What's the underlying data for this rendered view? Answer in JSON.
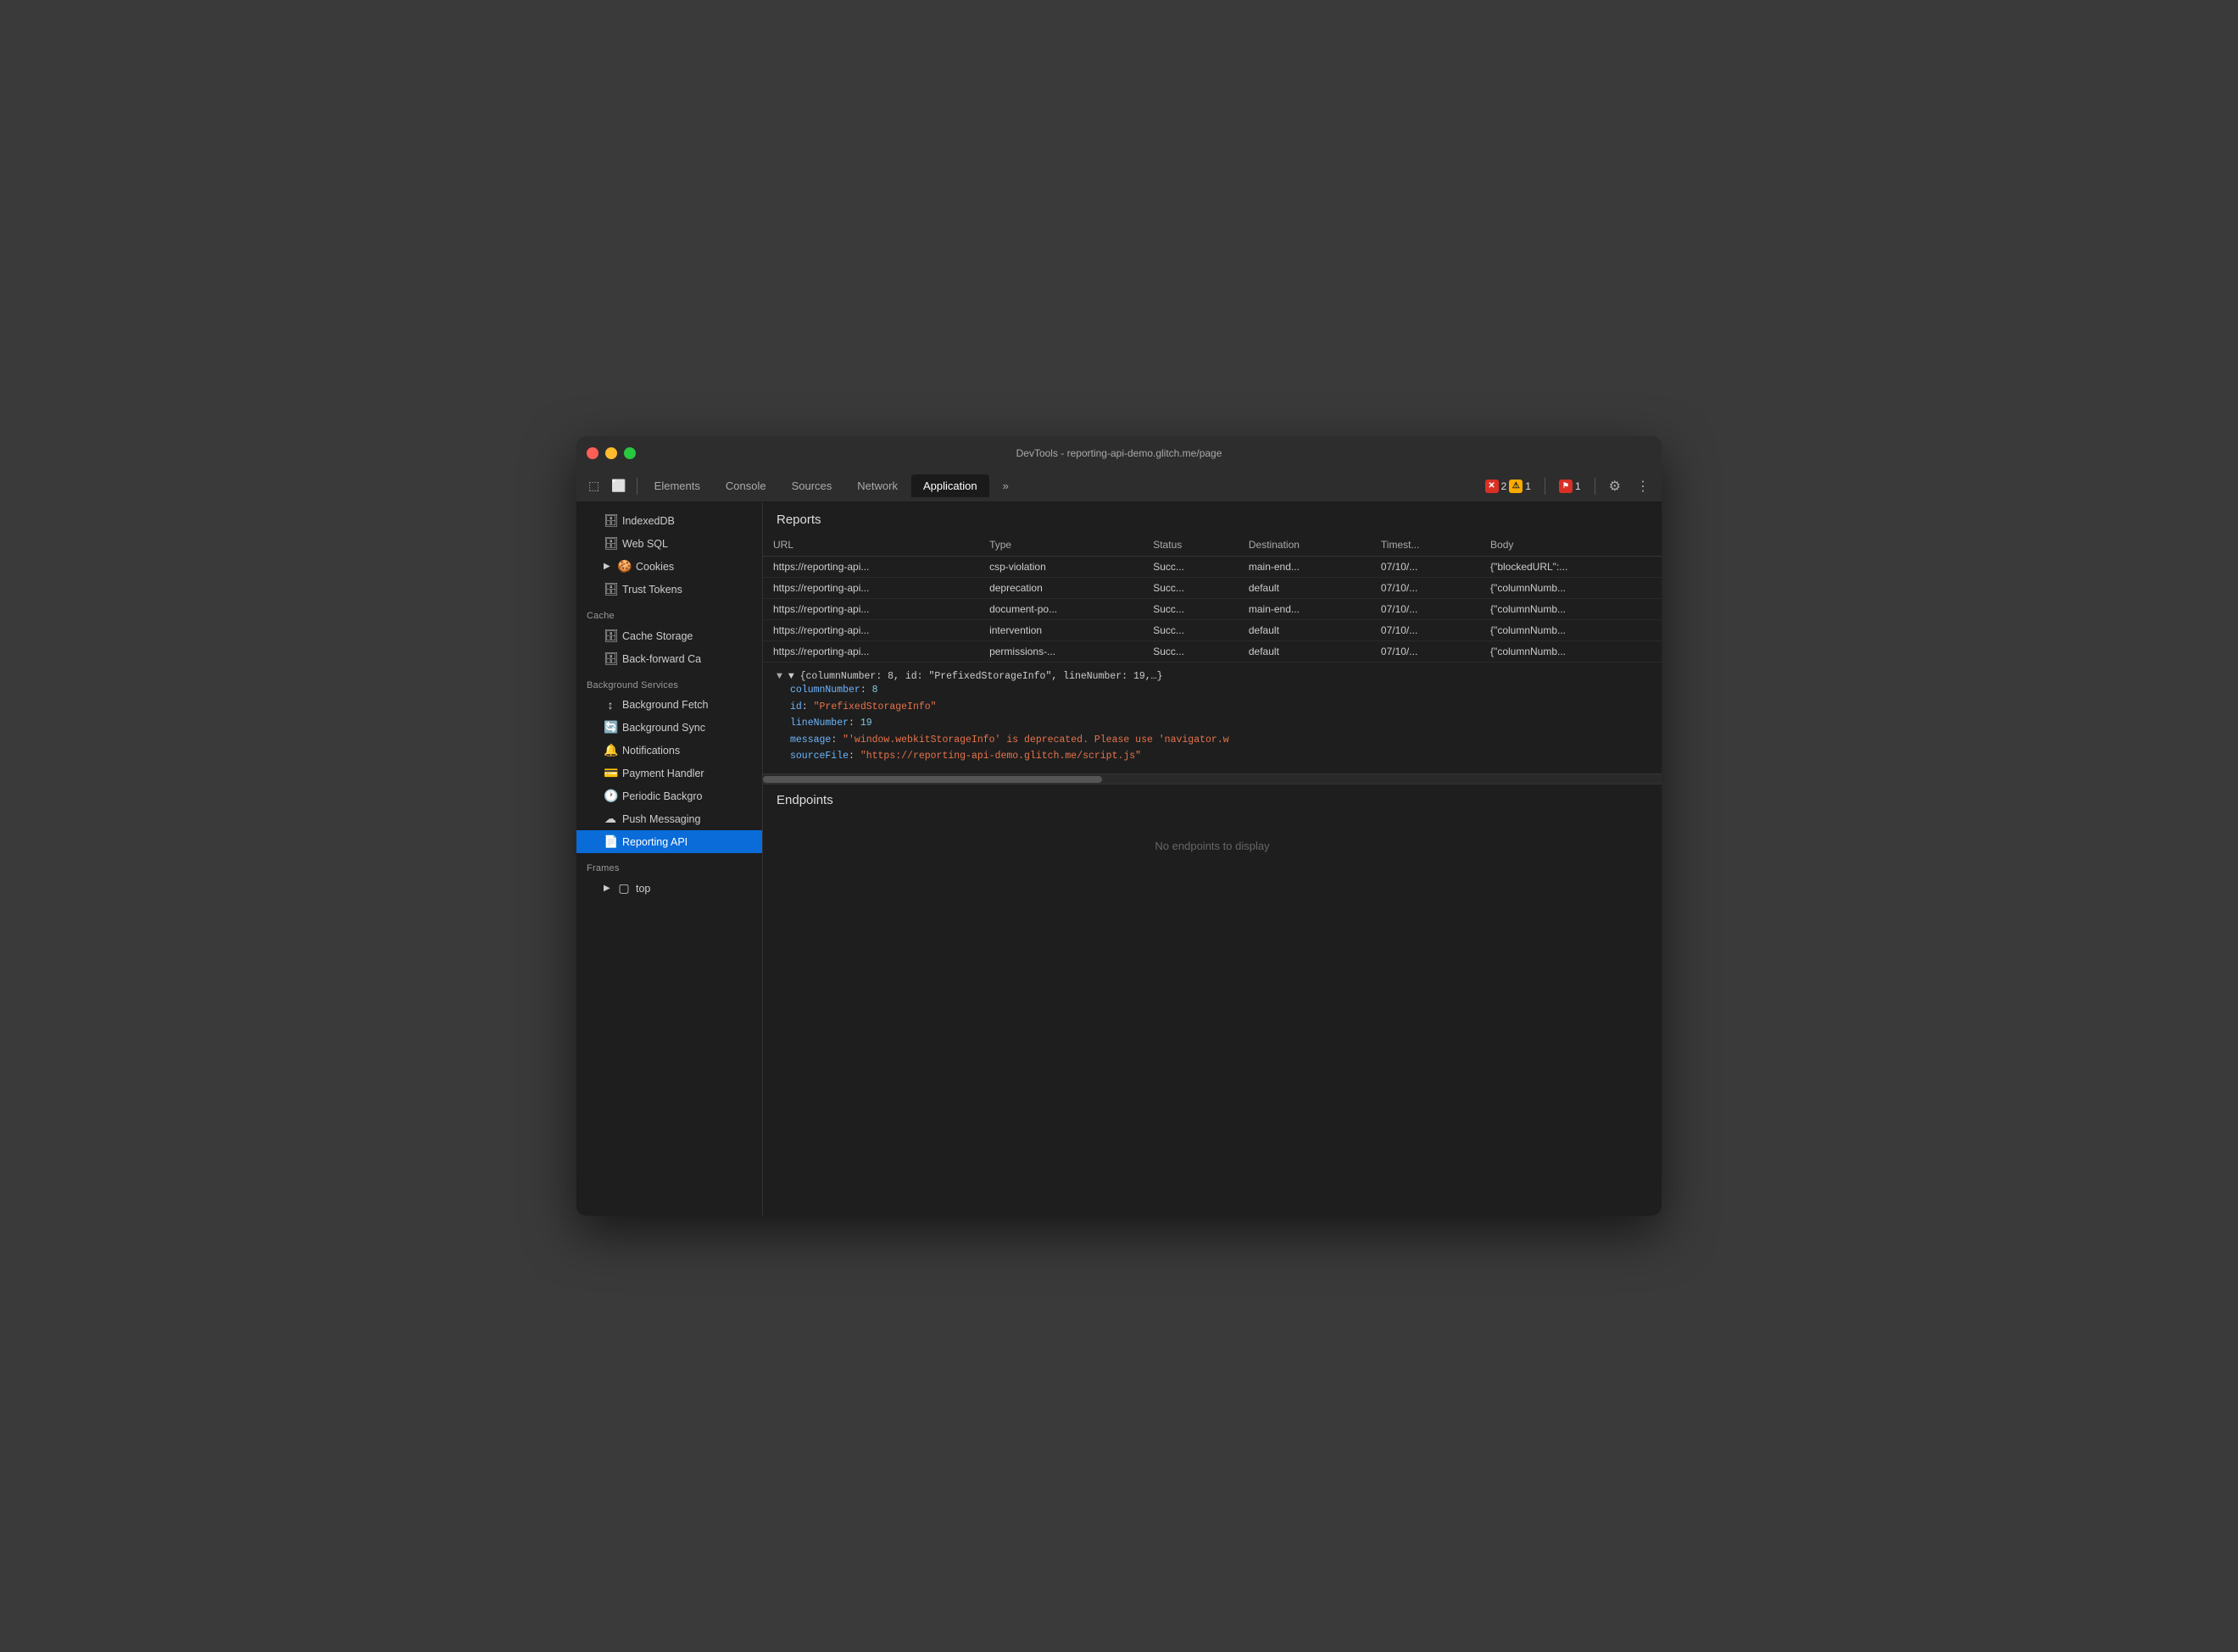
{
  "window": {
    "title": "DevTools - reporting-api-demo.glitch.me/page"
  },
  "tabs": {
    "items": [
      {
        "label": "Elements",
        "active": false
      },
      {
        "label": "Console",
        "active": false
      },
      {
        "label": "Sources",
        "active": false
      },
      {
        "label": "Network",
        "active": false
      },
      {
        "label": "Application",
        "active": true
      }
    ],
    "more_label": "»",
    "error_count": "2",
    "warn_count": "1",
    "report_count": "1",
    "settings_label": "⚙",
    "more_options_label": "⋮"
  },
  "sidebar": {
    "items": [
      {
        "id": "indexeddb",
        "label": "IndexedDB",
        "icon": "🗄",
        "indented": true
      },
      {
        "id": "websql",
        "label": "Web SQL",
        "icon": "🗄",
        "indented": true
      },
      {
        "id": "cookies",
        "label": "Cookies",
        "icon": "🍪",
        "indented": true,
        "expandable": true
      },
      {
        "id": "trusttokens",
        "label": "Trust Tokens",
        "icon": "🗄",
        "indented": true
      }
    ],
    "cache_section": "Cache",
    "cache_items": [
      {
        "id": "cachestorage",
        "label": "Cache Storage",
        "icon": "🗄"
      },
      {
        "id": "backforward",
        "label": "Back-forward Ca",
        "icon": "🗄"
      }
    ],
    "bgservices_section": "Background Services",
    "bgservices_items": [
      {
        "id": "bgfetch",
        "label": "Background Fetch",
        "icon": "↕"
      },
      {
        "id": "bgsync",
        "label": "Background Sync",
        "icon": "🔄"
      },
      {
        "id": "notifications",
        "label": "Notifications",
        "icon": "🔔"
      },
      {
        "id": "paymenthandler",
        "label": "Payment Handler",
        "icon": "💳"
      },
      {
        "id": "periodicbg",
        "label": "Periodic Backgro",
        "icon": "🕐"
      },
      {
        "id": "pushmessaging",
        "label": "Push Messaging",
        "icon": "☁"
      },
      {
        "id": "reportingapi",
        "label": "Reporting API",
        "icon": "📄",
        "active": true
      }
    ],
    "frames_section": "Frames",
    "frames_items": [
      {
        "id": "frametop",
        "label": "top",
        "icon": "▢",
        "expandable": true
      }
    ]
  },
  "reports": {
    "section_title": "Reports",
    "columns": [
      "URL",
      "Type",
      "Status",
      "Destination",
      "Timest...",
      "Body"
    ],
    "rows": [
      {
        "url": "https://reporting-api...",
        "type": "csp-violation",
        "status": "Succ...",
        "destination": "main-end...",
        "timestamp": "07/10/...",
        "body": "{\"blockedURL\":..."
      },
      {
        "url": "https://reporting-api...",
        "type": "deprecation",
        "status": "Succ...",
        "destination": "default",
        "timestamp": "07/10/...",
        "body": "{\"columnNumb..."
      },
      {
        "url": "https://reporting-api...",
        "type": "document-po...",
        "status": "Succ...",
        "destination": "main-end...",
        "timestamp": "07/10/...",
        "body": "{\"columnNumb..."
      },
      {
        "url": "https://reporting-api...",
        "type": "intervention",
        "status": "Succ...",
        "destination": "default",
        "timestamp": "07/10/...",
        "body": "{\"columnNumb..."
      },
      {
        "url": "https://reporting-api...",
        "type": "permissions-...",
        "status": "Succ...",
        "destination": "default",
        "timestamp": "07/10/...",
        "body": "{\"columnNumb..."
      }
    ]
  },
  "json_detail": {
    "summary": "▼ {columnNumber: 8, id: \"PrefixedStorageInfo\", lineNumber: 19,…}",
    "lines": [
      {
        "key": "columnNumber",
        "value": "8",
        "type": "number"
      },
      {
        "key": "id",
        "value": "\"PrefixedStorageInfo\"",
        "type": "string"
      },
      {
        "key": "lineNumber",
        "value": "19",
        "type": "number"
      },
      {
        "key": "message",
        "value": "\"'window.webkitStorageInfo' is deprecated. Please use 'navigator.w",
        "type": "string"
      },
      {
        "key": "sourceFile",
        "value": "\"https://reporting-api-demo.glitch.me/script.js\"",
        "type": "string"
      }
    ]
  },
  "endpoints": {
    "section_title": "Endpoints",
    "empty_message": "No endpoints to display"
  }
}
